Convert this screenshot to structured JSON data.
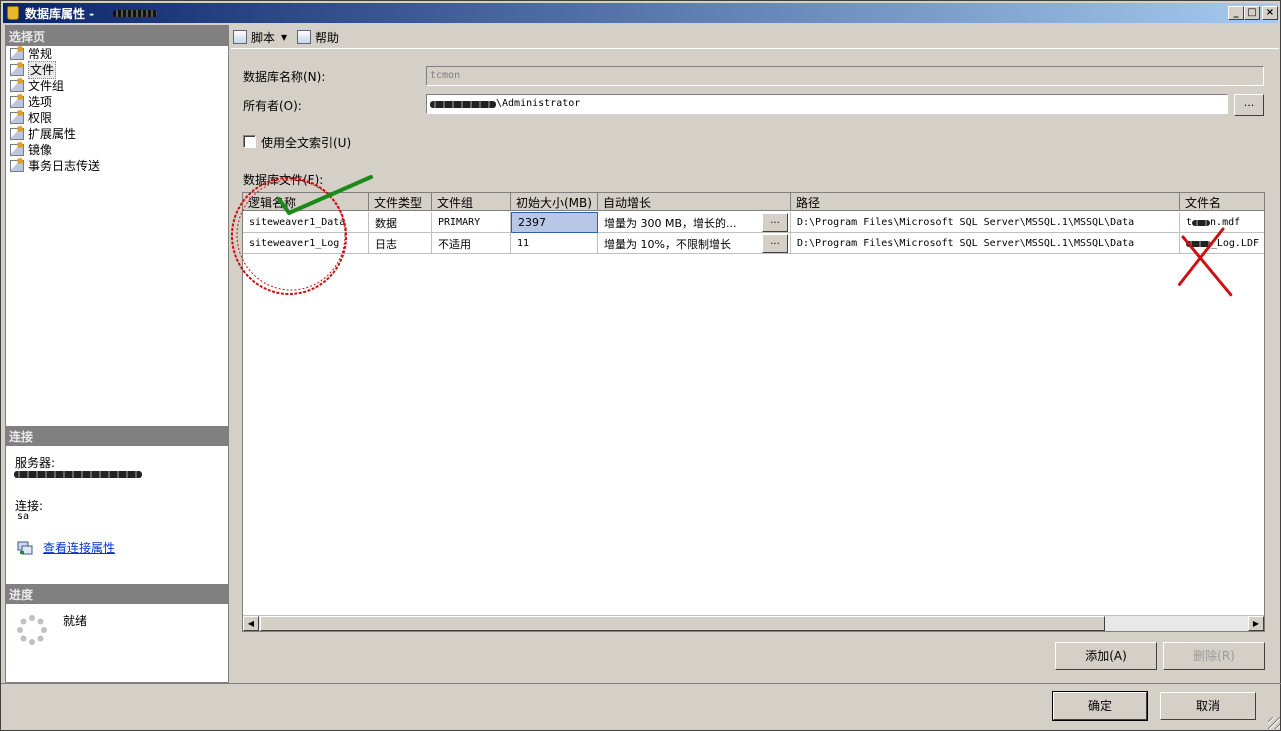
{
  "window": {
    "title": "数据库属性 - ",
    "minimize": "_",
    "maximize": "□",
    "close": "×"
  },
  "sidebar": {
    "select_page_header": "选择页",
    "pages": [
      {
        "label": "常规"
      },
      {
        "label": "文件"
      },
      {
        "label": "文件组"
      },
      {
        "label": "选项"
      },
      {
        "label": "权限"
      },
      {
        "label": "扩展属性"
      },
      {
        "label": "镜像"
      },
      {
        "label": "事务日志传送"
      }
    ],
    "selected_page": "文件",
    "connection_header": "连接",
    "server_label": "服务器:",
    "connection_label": "连接:",
    "connection_value": "sa",
    "view_conn_props": "查看连接属性",
    "progress_header": "进度",
    "progress_status": "就绪"
  },
  "toolbar": {
    "script_label": "脚本",
    "help_label": "帮助"
  },
  "form": {
    "db_name_label": "数据库名称(N):",
    "db_name_value": "tcmon",
    "owner_label": "所有者(O):",
    "owner_value": "\\Administrator",
    "owner_browse": "...",
    "fulltext_label": "使用全文索引(U)",
    "fulltext_checked": false,
    "db_files_label": "数据库文件(F):"
  },
  "grid": {
    "columns": [
      "逻辑名称",
      "文件类型",
      "文件组",
      "初始大小(MB)",
      "自动增长",
      "路径",
      "文件名"
    ],
    "rows": [
      {
        "logical_name": "siteweaver1_Data",
        "file_type": "数据",
        "filegroup": "PRIMARY",
        "initial_size": "2397",
        "autogrowth": "增量为 300 MB，增长的...",
        "autogrowth_btn": "...",
        "path": "D:\\Program Files\\Microsoft SQL Server\\MSSQL.1\\MSSQL\\Data",
        "file_name_prefix": "t",
        "file_name_suffix": "n.mdf"
      },
      {
        "logical_name": "siteweaver1_Log",
        "file_type": "日志",
        "filegroup": "不适用",
        "initial_size": "11",
        "autogrowth": "增量为 10%，不限制增长",
        "autogrowth_btn": "...",
        "path": "D:\\Program Files\\Microsoft SQL Server\\MSSQL.1\\MSSQL\\Data",
        "file_name_prefix": "",
        "file_name_suffix": "_Log.LDF"
      }
    ]
  },
  "buttons": {
    "add": "添加(A)",
    "remove": "删除(R)",
    "ok": "确定",
    "cancel": "取消"
  },
  "colors": {
    "annotation_red": "#cc1111",
    "annotation_green": "#1a8a1a",
    "title_gradient_start": "#0a246a",
    "title_gradient_end": "#a6caf0",
    "window_bg": "#d4d0c8"
  }
}
